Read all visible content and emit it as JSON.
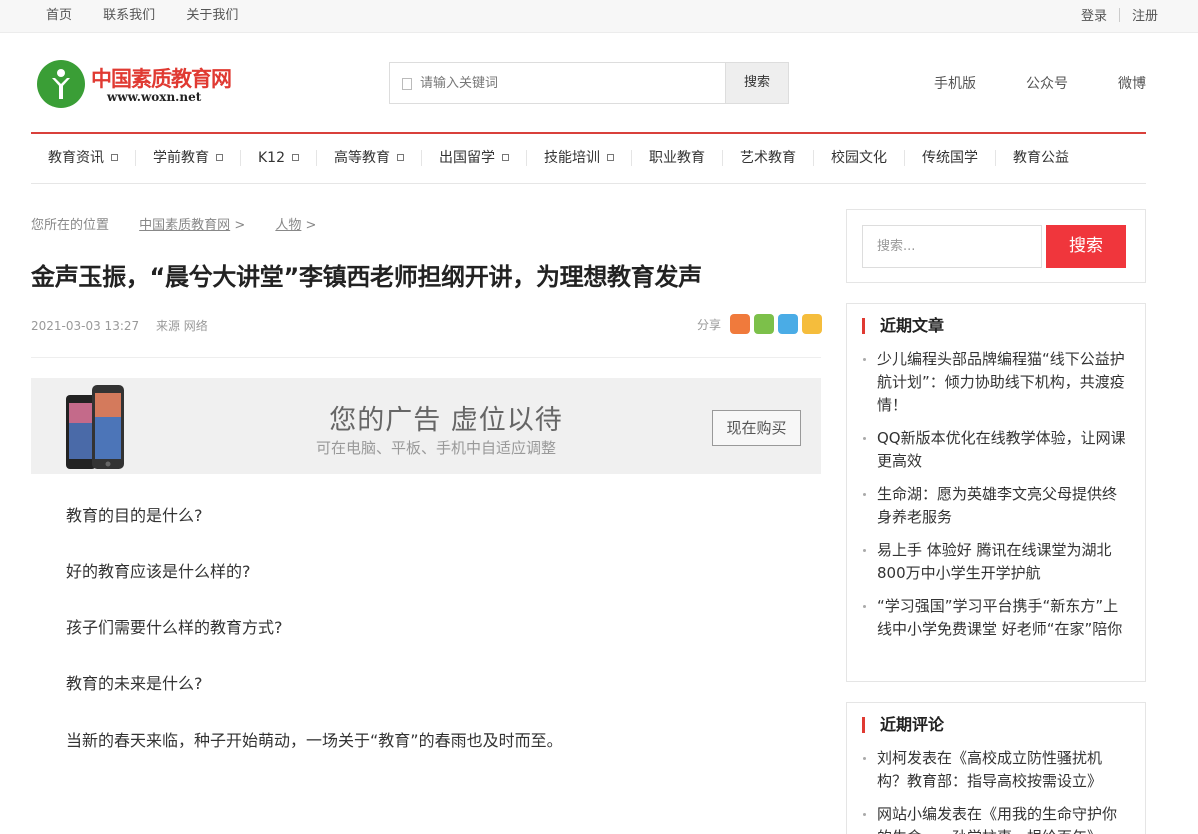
{
  "topbar": {
    "links": [
      "首页",
      "联系我们",
      "关于我们"
    ],
    "login": "登录",
    "register": "注册"
  },
  "header": {
    "logo_name": "中国素质教育网",
    "logo_url": "www.woxn.net",
    "search_placeholder": "请输入关键词",
    "search_button": "搜索",
    "links": [
      "手机版",
      "公众号",
      "微博"
    ]
  },
  "nav": {
    "items": [
      {
        "label": "教育资讯",
        "dropdown": true
      },
      {
        "label": "学前教育",
        "dropdown": true
      },
      {
        "label": "K12",
        "dropdown": true
      },
      {
        "label": "高等教育",
        "dropdown": true
      },
      {
        "label": "出国留学",
        "dropdown": true
      },
      {
        "label": "技能培训",
        "dropdown": true
      },
      {
        "label": "职业教育",
        "dropdown": false
      },
      {
        "label": "艺术教育",
        "dropdown": false
      },
      {
        "label": "校园文化",
        "dropdown": false
      },
      {
        "label": "传统国学",
        "dropdown": false
      },
      {
        "label": "教育公益",
        "dropdown": false
      }
    ]
  },
  "breadcrumb": {
    "label": "您所在的位置",
    "site": "中国素质教育网",
    "section": "人物",
    "separator": ">"
  },
  "article": {
    "title": "金声玉振，“晨兮大讲堂”李镇西老师担纲开讲，为理想教育发声",
    "date": "2021-03-03 13:27",
    "source": "来源 网络",
    "share_label": "分享",
    "share_colors": [
      "#f07a3c",
      "#7cc04a",
      "#4aace6",
      "#f5bd3c"
    ],
    "paragraphs": [
      "教育的目的是什么?",
      "好的教育应该是什么样的?",
      "孩子们需要什么样的教育方式?",
      "教育的未来是什么?",
      "当新的春天来临，种子开始萌动，一场关于“教育”的春雨也及时而至。"
    ]
  },
  "ad": {
    "headline": "您的广告 虚位以待",
    "subline": "可在电脑、平板、手机中自适应调整",
    "button": "现在购买"
  },
  "sidebar": {
    "search_placeholder": "搜索...",
    "search_button": "搜索",
    "recent_title": "近期文章",
    "recent": [
      "少儿编程头部品牌编程猫“线下公益护航计划”：倾力协助线下机构，共渡疫情！",
      "QQ新版本优化在线教学体验，让网课更高效",
      "生命湖：愿为英雄李文亮父母提供终身养老服务",
      "易上手 体验好 腾讯在线课堂为湖北800万中小学生开学护航",
      "“学习强国”学习平台携手“新东方”上线中小学免费课堂 好老师“在家”陪你"
    ],
    "comments_title": "近期评论",
    "comments": [
      "刘柯发表在《高校成立防性骚扰机构？教育部：指导高校按需设立》",
      "网站小编发表在《用我的生命守护你的生命——孙学柱事，捐给百年》"
    ]
  },
  "colors": {
    "brand_red": "#e03a32",
    "brand_green": "#3a9e36",
    "search_red": "#f0363c"
  }
}
